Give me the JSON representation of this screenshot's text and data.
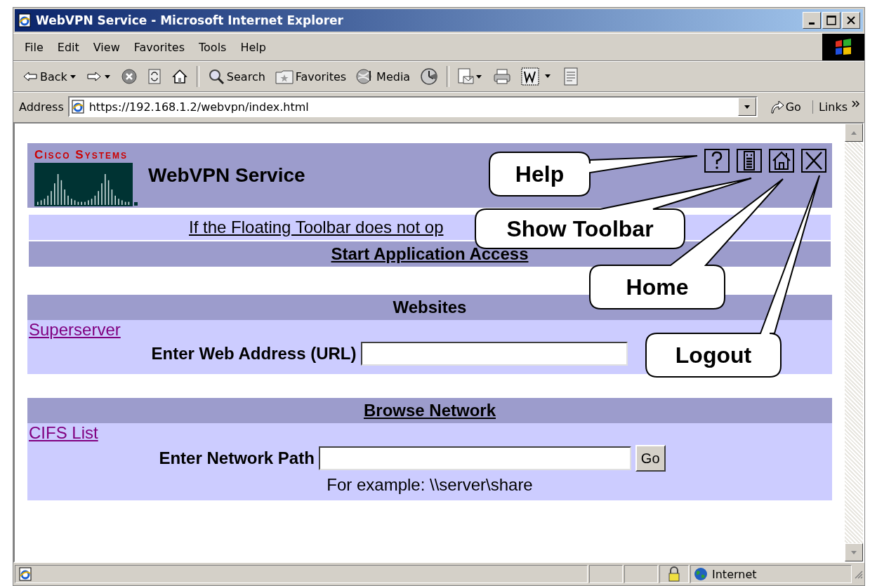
{
  "window": {
    "title": "WebVPN Service - Microsoft Internet Explorer"
  },
  "menu": [
    "File",
    "Edit",
    "View",
    "Favorites",
    "Tools",
    "Help"
  ],
  "toolbar": [
    {
      "kind": "back",
      "label": "Back"
    },
    {
      "kind": "forward"
    },
    {
      "kind": "stop"
    },
    {
      "kind": "refresh"
    },
    {
      "kind": "home"
    },
    {
      "kind": "search",
      "label": "Search"
    },
    {
      "kind": "favorites",
      "label": "Favorites"
    },
    {
      "kind": "media",
      "label": "Media"
    },
    {
      "kind": "history"
    },
    {
      "kind": "mail"
    },
    {
      "kind": "print"
    },
    {
      "kind": "edit"
    },
    {
      "kind": "discuss"
    }
  ],
  "address_bar": {
    "label": "Address",
    "value": "https://192.168.1.2/webvpn/index.html",
    "go": "Go",
    "links": "Links"
  },
  "page": {
    "brand": "Cisco Systems",
    "title": "WebVPN Service",
    "notice_link": "If the Floating Toolbar does not op",
    "app_access": "Start Application Access",
    "sections": [
      {
        "heading": "Websites",
        "heading_link": false,
        "link": "Superserver",
        "field_label": "Enter Web Address (URL)"
      },
      {
        "heading": "Browse Network",
        "heading_link": true,
        "link": "CIFS List",
        "field_label": "Enter Network Path",
        "button": "Go",
        "hint": "For example: \\\\server\\share"
      }
    ]
  },
  "callouts": [
    {
      "label": "Help"
    },
    {
      "label": "Show Toolbar"
    },
    {
      "label": "Home"
    },
    {
      "label": "Logout"
    }
  ],
  "status_bar": {
    "zone": "Internet"
  }
}
